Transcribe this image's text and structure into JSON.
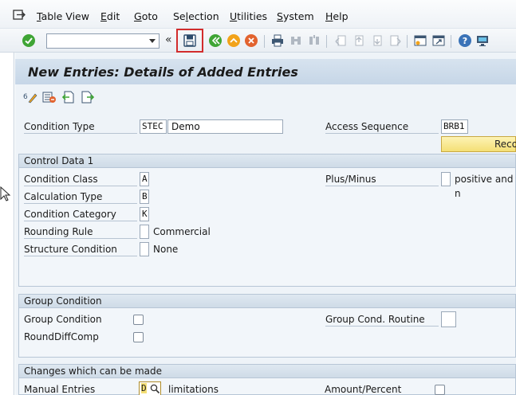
{
  "menu": {
    "items": [
      {
        "pre": "",
        "ul": "T",
        "post": "able View"
      },
      {
        "pre": "",
        "ul": "E",
        "post": "dit"
      },
      {
        "pre": "",
        "ul": "G",
        "post": "oto"
      },
      {
        "pre": "Se",
        "ul": "l",
        "post": "ection"
      },
      {
        "pre": "",
        "ul": "U",
        "post": "tilities"
      },
      {
        "pre": "",
        "ul": "S",
        "post": "ystem"
      },
      {
        "pre": "",
        "ul": "H",
        "post": "elp"
      }
    ]
  },
  "toolbar": {
    "command_value": "",
    "collapse_glyph": "«"
  },
  "title": "New Entries: Details of Added Entries",
  "header_fields": {
    "condition_type_label": "Condition Type",
    "condition_type_code": "STEC",
    "condition_type_desc": "Demo",
    "access_sequence_label": "Access Sequence",
    "access_sequence_value": "BRB1",
    "reco_button_label": "Reco"
  },
  "control_data": {
    "title": "Control Data 1",
    "condition_class_label": "Condition Class",
    "condition_class_value": "A",
    "calculation_type_label": "Calculation Type",
    "calculation_type_value": "B",
    "condition_category_label": "Condition Category",
    "condition_category_value": "K",
    "rounding_rule_label": "Rounding Rule",
    "rounding_rule_value": "",
    "rounding_rule_text": "Commercial",
    "structure_condition_label": "Structure Condition",
    "structure_condition_value": "",
    "structure_condition_text": "None",
    "plus_minus_label": "Plus/Minus",
    "plus_minus_value": "",
    "plus_minus_text": "positive and n"
  },
  "group_condition": {
    "title": "Group Condition",
    "group_condition_label": "Group Condition",
    "round_diff_label": "RoundDiffComp",
    "routine_label": "Group Cond. Routine",
    "routine_value": ""
  },
  "changes": {
    "title": "Changes which can be made",
    "manual_entries_label": "Manual Entries",
    "manual_entries_value": "D",
    "manual_entries_text": "limitations",
    "amount_percent_label": "Amount/Percent"
  },
  "colors": {
    "save_highlight": "#d22c2c",
    "reco_button": "#f4df75",
    "title_bar": "#c6d6e7"
  }
}
